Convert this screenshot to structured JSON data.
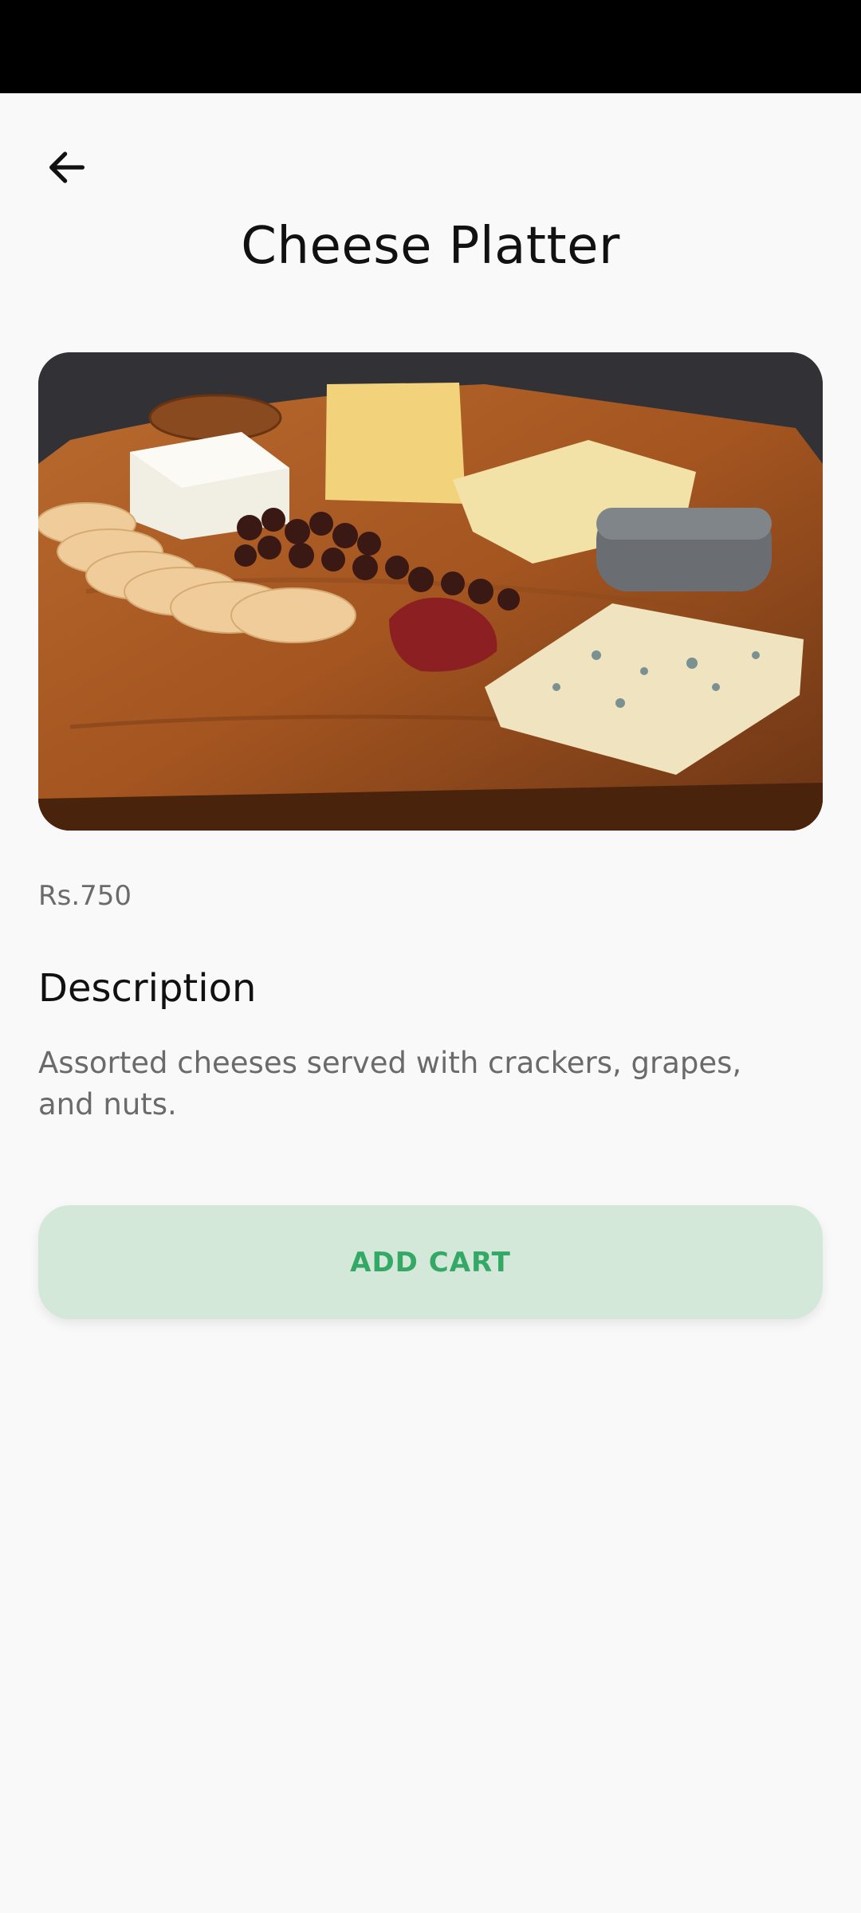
{
  "header": {
    "back_icon": "arrow-left-icon",
    "title": "Cheese Platter"
  },
  "product": {
    "image": "cheese-platter-photo",
    "price": "Rs.750",
    "description_heading": "Description",
    "description": "Assorted cheeses served with crackers, grapes, and nuts."
  },
  "actions": {
    "add_cart_label": "ADD CART"
  },
  "colors": {
    "accent": "#34a865",
    "button_bg": "#d4e8da",
    "background": "#f9f9f9"
  }
}
